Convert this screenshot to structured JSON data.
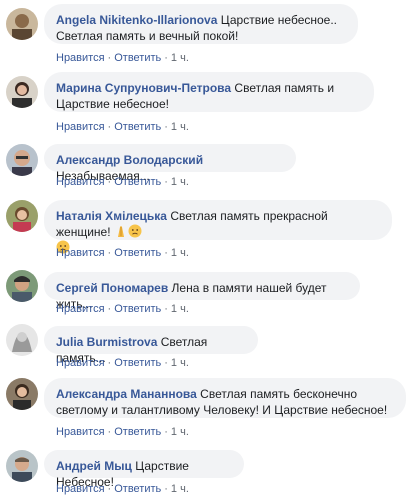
{
  "comments": [
    {
      "author": "Angela Nikitenko-Illarionova",
      "text": "Царствие небесное.. Светлая память и вечный покой!",
      "like": "Нравится",
      "reply": "Ответить",
      "time": "1 ч."
    },
    {
      "author": "Марина Супрунович-Петрова",
      "text": "Светлая память и Царствие небесное!",
      "like": "Нравится",
      "reply": "Ответить",
      "time": "1 ч."
    },
    {
      "author": "Александр Володарский",
      "text": "Незабываемая...",
      "like": "Нравится",
      "reply": "Ответить",
      "time": "1 ч."
    },
    {
      "author": "Наталія Хмілецька",
      "text": "Светлая память прекрасной женщине!",
      "like": "Нравится",
      "reply": "Ответить",
      "time": "1 ч."
    },
    {
      "author": "Сергей Пономарев",
      "text": "Лена в памяти нашей будет жить...",
      "like": "Нравится",
      "reply": "Ответить",
      "time": "1 ч."
    },
    {
      "author": "Julia Burmistrova",
      "text": "Светлая память...",
      "like": "Нравится",
      "reply": "Ответить",
      "time": "1 ч."
    },
    {
      "author": "Александра Мананнова",
      "text": "Светлая память бесконечно светлому и талантливому Человеку! И Царствие небесное!",
      "like": "Нравится",
      "reply": "Ответить",
      "time": "1 ч."
    },
    {
      "author": "Андрей Мыц",
      "text": "Царствие Небесное!",
      "like": "Нравится",
      "reply": "Ответить",
      "time": "1 ч."
    }
  ],
  "colors": {
    "link": "#385898",
    "bubble": "#f2f3f5",
    "meta": "#616770"
  },
  "icons": {
    "pray_emoji": "folded-hands-icon",
    "sad_emoji": "sad-face-icon"
  }
}
